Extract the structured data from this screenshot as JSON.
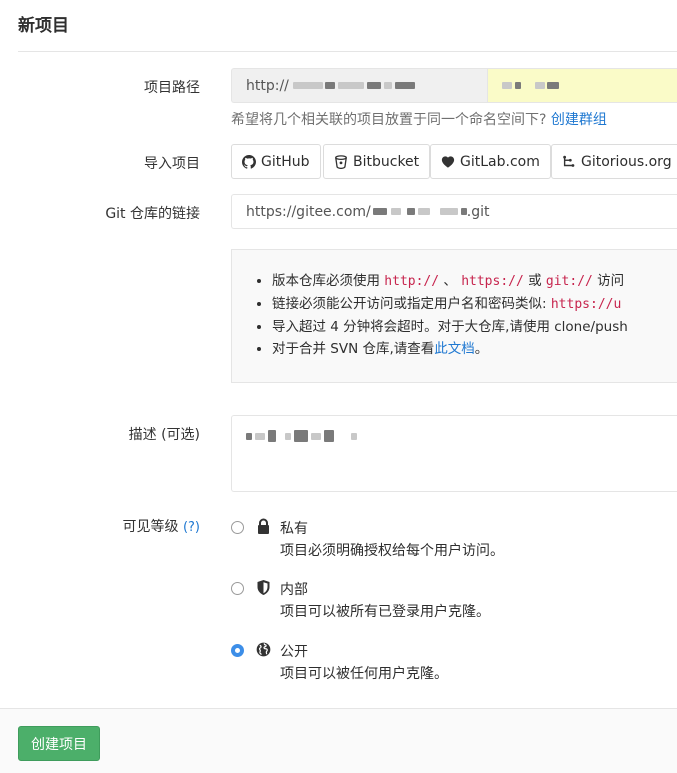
{
  "page": {
    "title": "新项目"
  },
  "project_path": {
    "label": "项目路径",
    "prefix": "http://",
    "hint_text": "希望将几个相关联的项目放置于同一个命名空间下?",
    "hint_link": "创建群组"
  },
  "import": {
    "label": "导入项目",
    "buttons": [
      {
        "label": "GitHub",
        "icon": "github-icon"
      },
      {
        "label": "Bitbucket",
        "icon": "bitbucket-icon"
      },
      {
        "label": "GitLab.com",
        "icon": "gitlab-icon"
      },
      {
        "label": "Gitorious.org",
        "icon": "gitorious-icon"
      }
    ]
  },
  "git_url": {
    "label": "Git 仓库的链接",
    "value_start": "https://gitee.com/",
    "value_end": ".git"
  },
  "info": {
    "line1_a": "版本仓库必须使用",
    "line1_code1": "http://",
    "line1_sep": "、",
    "line1_code2": "https://",
    "line1_or": "或",
    "line1_code3": "git://",
    "line1_end": "访问",
    "line2_a": "链接必须能公开访问或指定用户名和密码类似:",
    "line2_code": "https://u",
    "line3": "导入超过 4 分钟将会超时。对于大仓库,请使用 clone/push",
    "line4_a": "对于合并 SVN 仓库,请查看",
    "line4_link": "此文档",
    "line4_end": "。"
  },
  "description": {
    "label": "描述 (可选)"
  },
  "visibility": {
    "label": "可见等级",
    "help": "(?)",
    "options": [
      {
        "title": "私有",
        "desc": "项目必须明确授权给每个用户访问。",
        "icon": "lock-icon",
        "checked": false
      },
      {
        "title": "内部",
        "desc": "项目可以被所有已登录用户克隆。",
        "icon": "shield-icon",
        "checked": false
      },
      {
        "title": "公开",
        "desc": "项目可以被任何用户克隆。",
        "icon": "globe-icon",
        "checked": true
      }
    ]
  },
  "footer": {
    "create_label": "创建项目"
  },
  "colors": {
    "accent": "#1f78d1",
    "create_button": "#4caf6a",
    "path_highlight": "#fafbc8",
    "code": "#c7254e"
  }
}
